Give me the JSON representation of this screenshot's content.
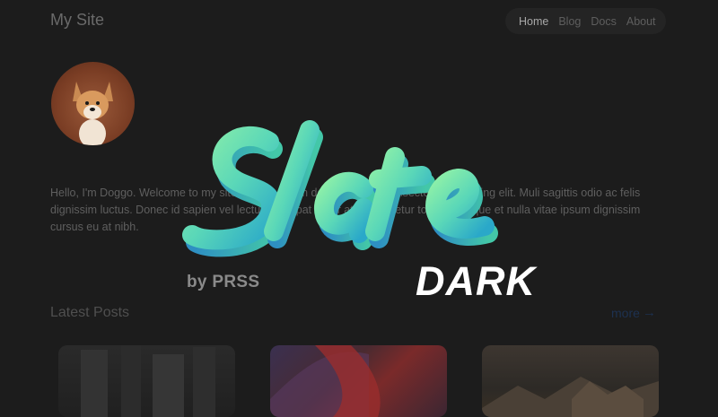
{
  "header": {
    "site_title": "My Site",
    "nav": [
      {
        "label": "Home",
        "active": true
      },
      {
        "label": "Blog",
        "active": false
      },
      {
        "label": "Docs",
        "active": false
      },
      {
        "label": "About",
        "active": false
      }
    ]
  },
  "intro": {
    "text": "Hello, I'm Doggo. Welcome to my site. Lorem ipsum dolor sit amet, consectetur adipiscing elit. Muli sagittis odio ac felis dignissim luctus. Donec id sapien vel lectus, volutpat tortor at consectetur tortor. Quisque et nulla vitae ipsum dignissim cursus eu at nibh."
  },
  "latest_posts": {
    "heading": "Latest Posts",
    "more_label": "more",
    "more_arrow": "→"
  },
  "overlay": {
    "logo_word": "Slate",
    "byline": "by PRSS",
    "variant": "DARK"
  },
  "colors": {
    "background": "#1c1c1c",
    "logo_gradient_start": "#7ce6a0",
    "logo_gradient_end": "#2fa6c8"
  }
}
